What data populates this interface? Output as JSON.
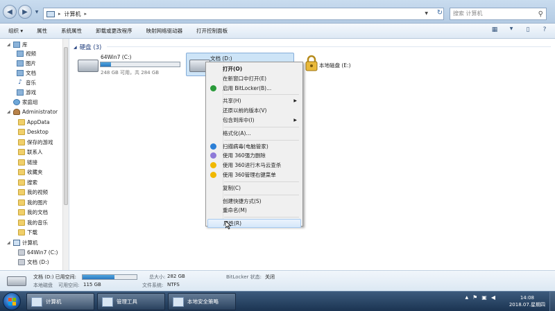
{
  "address": {
    "crumb": "计算机",
    "search_placeholder": "搜索 计算机"
  },
  "toolbar": {
    "items": [
      "组织 ▾",
      "属性",
      "系统属性",
      "卸载或更改程序",
      "映射网络驱动器",
      "打开控制面板"
    ]
  },
  "nav": {
    "items": [
      {
        "label": "库",
        "icon": "library-icon"
      },
      {
        "label": "视频",
        "icon": "video-icon"
      },
      {
        "label": "图片",
        "icon": "picture-icon"
      },
      {
        "label": "文档",
        "icon": "document-icon"
      },
      {
        "label": "音乐",
        "icon": "music-icon"
      },
      {
        "label": "游戏",
        "icon": "game-icon"
      },
      {
        "label": "家庭组",
        "icon": "homegroup-icon"
      },
      {
        "label": "Administrator",
        "icon": "user-icon"
      },
      {
        "label": "AppData",
        "icon": "folder-icon"
      },
      {
        "label": "Desktop",
        "icon": "folder-icon"
      },
      {
        "label": "保存的游戏",
        "icon": "folder-icon"
      },
      {
        "label": "联系人",
        "icon": "folder-icon"
      },
      {
        "label": "链接",
        "icon": "folder-icon"
      },
      {
        "label": "收藏夹",
        "icon": "folder-icon"
      },
      {
        "label": "搜索",
        "icon": "folder-icon"
      },
      {
        "label": "我的视频",
        "icon": "folder-icon"
      },
      {
        "label": "我的图片",
        "icon": "folder-icon"
      },
      {
        "label": "我的文档",
        "icon": "folder-icon"
      },
      {
        "label": "我的音乐",
        "icon": "folder-icon"
      },
      {
        "label": "下载",
        "icon": "folder-icon"
      },
      {
        "label": "计算机",
        "icon": "computer-icon"
      },
      {
        "label": "64Win7 (C:)",
        "icon": "drive-icon"
      },
      {
        "label": "文档 (D:)",
        "icon": "drive-icon"
      }
    ]
  },
  "content": {
    "group_title": "硬盘 (3)",
    "drives": [
      {
        "name": "64Win7  (C:)",
        "free_text": "248 GB 可用，共 284 GB",
        "used_fraction": 0.13
      },
      {
        "name": "文档 (D:)"
      },
      {
        "name": "本地磁盘 (E:)"
      }
    ]
  },
  "context_menu": {
    "items": [
      {
        "label": "打开(O)",
        "bold": true
      },
      {
        "label": "在新窗口中打开(E)"
      },
      {
        "label": "启用 BitLocker(B)..."
      },
      {
        "sep": true
      },
      {
        "label": "共享(H)",
        "sub": true
      },
      {
        "label": "还原以前的版本(V)"
      },
      {
        "label": "包含到库中(I)",
        "sub": true
      },
      {
        "sep": true
      },
      {
        "label": "格式化(A)..."
      },
      {
        "sep": true
      },
      {
        "label": "扫描病毒(电脑管家)"
      },
      {
        "label": "使用 360强力删除"
      },
      {
        "label": "使用 360进行木马云查杀"
      },
      {
        "label": "使用 360管理右键菜单"
      },
      {
        "sep": true
      },
      {
        "label": "复制(C)"
      },
      {
        "sep": true
      },
      {
        "label": "创建快捷方式(S)"
      },
      {
        "label": "重命名(M)"
      },
      {
        "sep": true
      },
      {
        "label": "属性(R)",
        "highlight": true
      }
    ]
  },
  "details": {
    "drive_title": "文档 (D:)  已用空间:",
    "drive_type": "本地磁盘",
    "free_label": "可用空间:",
    "free_value": "115 GB",
    "total_label": "总大小:",
    "total_value": "282 GB",
    "fs_label": "文件系统:",
    "fs_value": "NTFS",
    "bitlocker_label": "BitLocker 状态:",
    "bitlocker_value": "关闭",
    "used_fraction": 0.59
  },
  "taskbar": {
    "tasks": [
      "计算机",
      "管理工具",
      "本地安全策略"
    ],
    "time": "14:08",
    "date": "2018.07.星期四"
  },
  "colors": {
    "accent": "#2a78c0",
    "selection": "#cde4f7",
    "taskbar": "#1b3452"
  }
}
